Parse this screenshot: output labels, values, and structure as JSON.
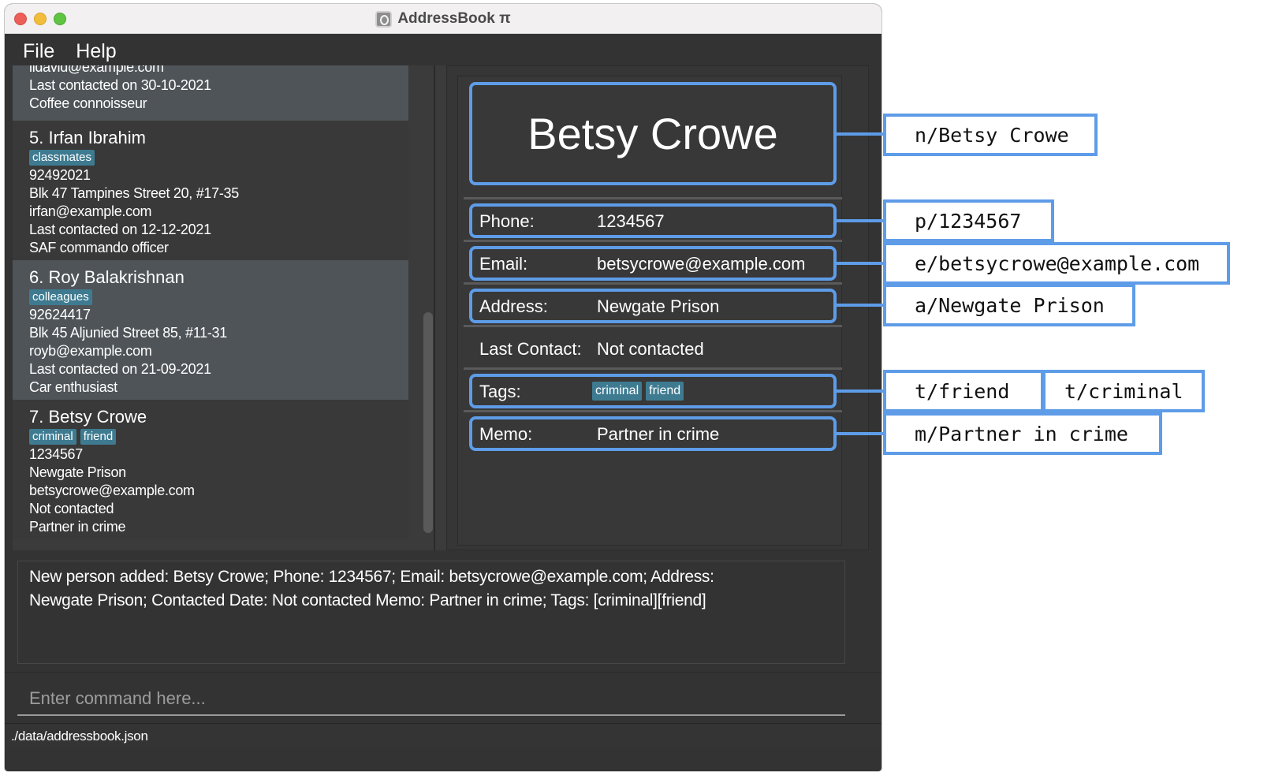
{
  "window": {
    "title": "AddressBook π"
  },
  "menu": {
    "file": "File",
    "help": "Help"
  },
  "contacts": {
    "partial": {
      "email": "lidavid@example.com",
      "last_contacted": "Last contacted on 30-10-2021",
      "memo": "Coffee connoisseur"
    },
    "c5": {
      "name": "5.  Irfan Ibrahim",
      "tags": [
        "classmates"
      ],
      "phone": "92492021",
      "address": "Blk 47 Tampines Street 20, #17-35",
      "email": "irfan@example.com",
      "last_contacted": "Last contacted on 12-12-2021",
      "memo": "SAF commando officer"
    },
    "c6": {
      "name": "6.  Roy Balakrishnan",
      "tags": [
        "colleagues"
      ],
      "phone": "92624417",
      "address": "Blk 45 Aljunied Street 85, #11-31",
      "email": "royb@example.com",
      "last_contacted": "Last contacted on 21-09-2021",
      "memo": "Car enthusiast"
    },
    "c7": {
      "name": "7.  Betsy Crowe",
      "tags": [
        "criminal",
        "friend"
      ],
      "phone": "1234567",
      "address": "Newgate Prison",
      "email": "betsycrowe@example.com",
      "last_contacted": "Not contacted",
      "memo": "Partner in crime"
    }
  },
  "detail": {
    "name": "Betsy Crowe",
    "phone_label": "Phone:",
    "phone": "1234567",
    "email_label": "Email:",
    "email": "betsycrowe@example.com",
    "address_label": "Address:",
    "address": "Newgate Prison",
    "last_contact_label": "Last Contact:",
    "last_contact": "Not contacted",
    "tags_label": "Tags:",
    "tags": [
      "criminal",
      "friend"
    ],
    "memo_label": "Memo:",
    "memo": "Partner in crime"
  },
  "result": {
    "line1": "New person added: Betsy Crowe; Phone: 1234567; Email: betsycrowe@example.com; Address:",
    "line2": "Newgate Prison; Contacted Date: Not contacted Memo: Partner in crime; Tags: [criminal][friend]"
  },
  "command": {
    "placeholder": "Enter command here..."
  },
  "status": {
    "path": "./data/addressbook.json"
  },
  "annotations": {
    "name": "n/Betsy Crowe",
    "phone": "p/1234567",
    "email": "e/betsycrowe@example.com",
    "address": "a/Newgate Prison",
    "tag_friend": "t/friend",
    "tag_criminal": "t/criminal",
    "memo": "m/Partner in crime"
  },
  "colors": {
    "accent": "#5e9ce8",
    "tag_bg": "#3e7b91",
    "window_bg": "#333333",
    "selected_card": "#4f5458"
  },
  "icons": {
    "app": "addressbook-app-icon"
  }
}
